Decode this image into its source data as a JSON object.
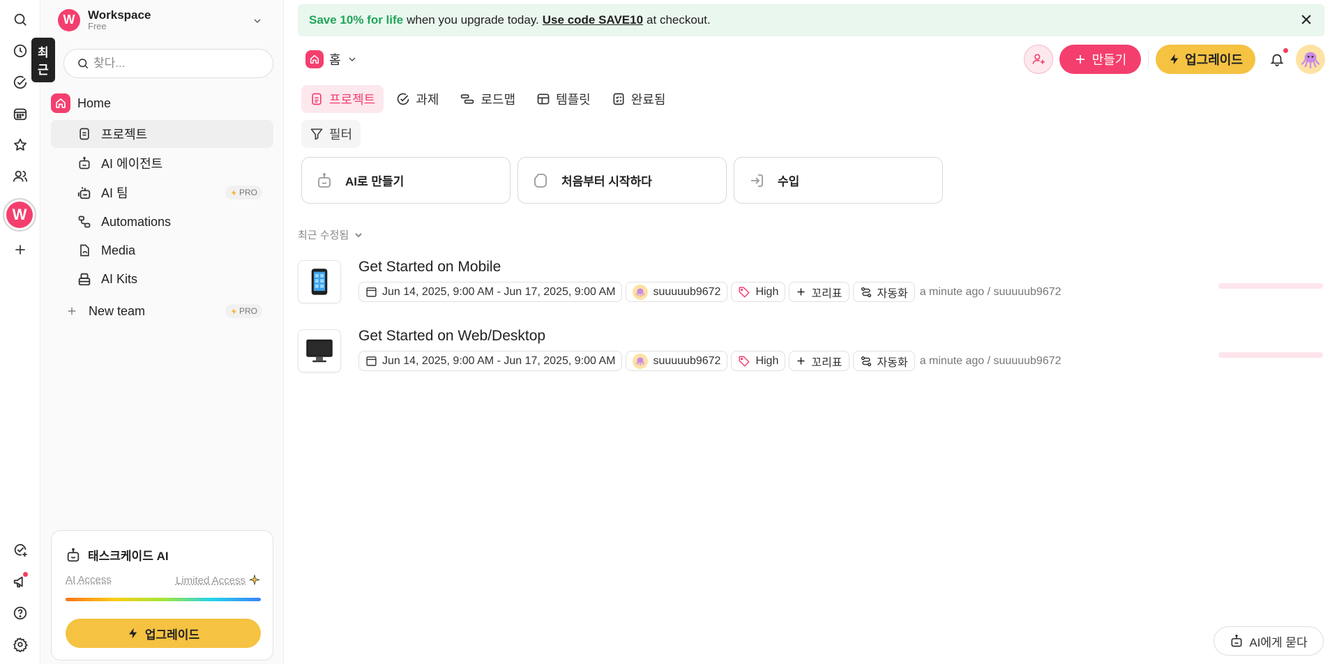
{
  "rail": {
    "tooltip": "최근",
    "workspace_letter": "W"
  },
  "sidebar": {
    "workspace_name": "Workspace",
    "workspace_plan": "Free",
    "workspace_letter": "W",
    "search_placeholder": "찾다...",
    "home_label": "Home",
    "items": [
      {
        "label": "프로젝트",
        "icon": "file-text-icon"
      },
      {
        "label": "AI 에이전트",
        "icon": "robot-icon"
      },
      {
        "label": "AI 팀",
        "icon": "robot-team-icon",
        "badge": "PRO"
      },
      {
        "label": "Automations",
        "icon": "automation-icon"
      },
      {
        "label": "Media",
        "icon": "media-icon"
      },
      {
        "label": "AI Kits",
        "icon": "kits-icon"
      }
    ],
    "new_team_label": "New team",
    "new_team_badge": "PRO",
    "ai_card": {
      "title": "태스크케이드 AI",
      "access_label": "AI Access",
      "access_value": "Limited Access",
      "upgrade_label": "업그레이드"
    }
  },
  "banner": {
    "highlight": "Save 10% for life",
    "text1": "when you upgrade today.",
    "code_text": "Use code SAVE10",
    "text2": "at checkout."
  },
  "header": {
    "breadcrumb": "홈",
    "create_label": "만들기",
    "upgrade_label": "업그레이드"
  },
  "tabs": [
    {
      "label": "프로젝트",
      "active": true
    },
    {
      "label": "과제"
    },
    {
      "label": "로드맵"
    },
    {
      "label": "템플릿"
    },
    {
      "label": "완료됨"
    }
  ],
  "filter_label": "필터",
  "quick_cards": [
    {
      "label": "AI로 만들기",
      "icon": "robot-icon"
    },
    {
      "label": "처음부터 시작하다",
      "icon": "blank-page-icon"
    },
    {
      "label": "수입",
      "icon": "import-icon"
    }
  ],
  "recent_heading": "최근 수정됨",
  "projects": [
    {
      "title": "Get Started on Mobile",
      "thumb": "mobile-phone-icon",
      "dates": "Jun 14, 2025, 9:00 AM - Jun 17, 2025, 9:00 AM",
      "user": "suuuuub9672",
      "priority": "High",
      "tag_label": "꼬리표",
      "automation_label": "자동화",
      "updated": "a minute ago / suuuuub9672"
    },
    {
      "title": "Get Started on Web/Desktop",
      "thumb": "desktop-monitor-icon",
      "dates": "Jun 14, 2025, 9:00 AM - Jun 17, 2025, 9:00 AM",
      "user": "suuuuub9672",
      "priority": "High",
      "tag_label": "꼬리표",
      "automation_label": "자동화",
      "updated": "a minute ago / suuuuub9672"
    }
  ],
  "ask_ai_label": "AI에게 묻다",
  "colors": {
    "brand": "#f43f6e",
    "upgrade": "#f5c242",
    "banner_bg": "#e9f7ee",
    "banner_green": "#22a55b"
  }
}
